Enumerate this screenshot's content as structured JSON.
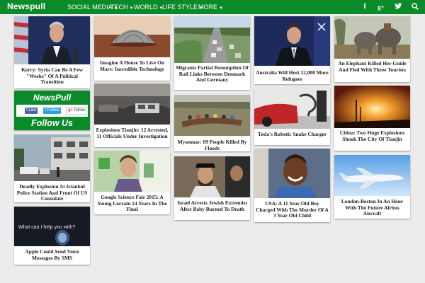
{
  "site": {
    "name": "Newspull"
  },
  "nav": [
    {
      "label": "SOCIAL MEDIA"
    },
    {
      "label": "TECH"
    },
    {
      "label": "WORLD"
    },
    {
      "label": "LIFE STYLE"
    },
    {
      "label": "MORE"
    }
  ],
  "top_icons": [
    "facebook-icon",
    "google-plus-icon",
    "twitter-icon",
    "search-icon"
  ],
  "widget": {
    "title": "NewsPull",
    "follow": "Follow Us",
    "like": "Like",
    "follow_btn": "Follow",
    "gplus": "follow"
  },
  "articles": [
    {
      "title": "Kerry: Syria Can Be A Few \"Weeks\" Of A Political Transition"
    },
    {
      "title": "Deadly Explosion At Istanbul Police Station And Front Of US Consulate"
    },
    {
      "title": "Apple Could Send Voice Messages By SMS",
      "image_text": "What can I help you with?"
    },
    {
      "title": "Imagine A House To Live On Mars: Incredible Technology"
    },
    {
      "title": "Explosions Tianjin: 12 Arrested, 11 Officials Under Investigation"
    },
    {
      "title": "Google Science Fair 2015: A Young Lorrain 14 Years In The Final"
    },
    {
      "title": "Migrants Partial Resumption Of Rail Links Between Denmark And Germany"
    },
    {
      "title": "Myanmar: 69 People Killed By Floods"
    },
    {
      "title": "Israel Arrests Jewish Extremist After Baby Burned To Death"
    },
    {
      "title": "Australia Will Host 12,000 More Refugees"
    },
    {
      "title": "Tesla's Robotic Snake Charger"
    },
    {
      "title": "USA: A 11 Year Old Boy Charged With The Murder Of A 3 Year Old Child"
    },
    {
      "title": "An Elephant Killed Her Guide And Fled With Three Tourists"
    },
    {
      "title": "China: Two Huge Explosions Shook The City Of Tianjin"
    },
    {
      "title": "London-Boston In An Hour With The Future Airbus Aircraft"
    }
  ]
}
